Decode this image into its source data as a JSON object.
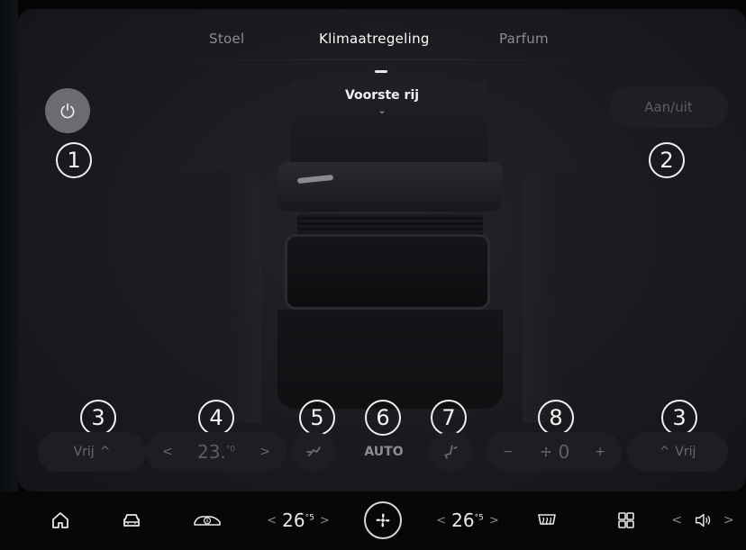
{
  "tabs": [
    {
      "label": "Stoel",
      "active": false
    },
    {
      "label": "Klimaatregeling",
      "active": true
    },
    {
      "label": "Parfum",
      "active": false
    }
  ],
  "row_selector": {
    "label": "Voorste rij",
    "icon": "chevron-down-icon"
  },
  "power_button": {
    "icon": "power-icon"
  },
  "onoff_button": {
    "label": "Aan/uit"
  },
  "badges": [
    "1",
    "2",
    "3",
    "4",
    "5",
    "6",
    "7",
    "8",
    "3"
  ],
  "controls": {
    "left_airflow": {
      "label": "Vrij",
      "icon": "chevron-up-icon"
    },
    "temperature": {
      "value": "23",
      "decimal": "0",
      "unit_symbol": "°",
      "decrease": "<",
      "increase": ">"
    },
    "airflow_icon": "airflow-face-icon",
    "auto_label": "AUTO",
    "seat_icon": "seat-airflow-icon",
    "fan": {
      "value": "0",
      "decrease": "−",
      "increase": "+",
      "icon": "fan-icon"
    },
    "right_airflow": {
      "label": "Vrij",
      "icon": "chevron-up-icon"
    }
  },
  "bottom_bar": {
    "home_icon": "home-icon",
    "car_icon": "car-icon",
    "auto_car_icon": "auto-car-icon",
    "driver_temp": {
      "value": "26",
      "decimal": "5",
      "unit_symbol": "°",
      "decrease": "<",
      "increase": ">"
    },
    "fan_icon": "fan-icon",
    "passenger_temp": {
      "value": "26",
      "decimal": "5",
      "unit_symbol": "°",
      "decrease": "<",
      "increase": ">"
    },
    "rear_defrost_icon": "rear-defrost-icon",
    "apps_icon": "apps-grid-icon",
    "volume": {
      "decrease": "<",
      "increase": ">",
      "icon": "volume-icon"
    }
  }
}
